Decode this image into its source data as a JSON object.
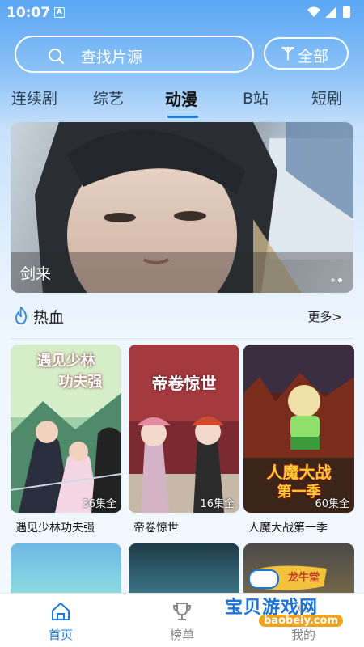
{
  "status_bar": {
    "time": "10:07",
    "notification_letter": "A"
  },
  "search": {
    "placeholder": "查找片源",
    "filter_label": "全部"
  },
  "tabs": [
    {
      "label": "连续剧",
      "active": false
    },
    {
      "label": "综艺",
      "active": false
    },
    {
      "label": "动漫",
      "active": true
    },
    {
      "label": "B站",
      "active": false
    },
    {
      "label": "短剧",
      "active": false
    }
  ],
  "banner": {
    "title": "剑来",
    "slide_count": 2,
    "active_slide": 1
  },
  "section": {
    "title": "热血",
    "more_label": "更多>"
  },
  "cards": [
    {
      "title": "遇见少林功夫强",
      "badge": "36集全",
      "poster_text": [
        "遇见少林",
        "功夫强"
      ]
    },
    {
      "title": "帝卷惊世",
      "badge": "16集全",
      "poster_text": [
        "帝卷惊世"
      ]
    },
    {
      "title": "人魔大战第一季",
      "badge": "60集全",
      "poster_text": [
        "人魔大战",
        "第一季"
      ]
    }
  ],
  "bottom_nav": [
    {
      "label": "首页",
      "icon": "home-icon",
      "active": true
    },
    {
      "label": "榜单",
      "icon": "trophy-icon",
      "active": false
    },
    {
      "label": "我的",
      "icon": "user-icon",
      "active": false
    }
  ],
  "watermark": {
    "title": "宝贝游戏网",
    "url": "baobeiy.com",
    "badge": "龙牛堂"
  },
  "colors": {
    "accent": "#1e7be0",
    "header_top": "#5aa6f3",
    "nav_active": "#1e7be0",
    "nav_inactive": "#888888"
  }
}
